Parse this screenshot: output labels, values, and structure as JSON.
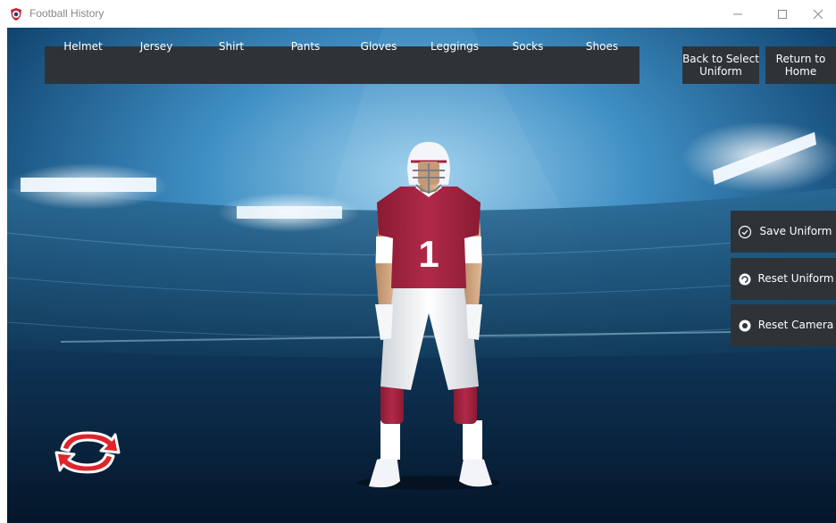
{
  "window": {
    "title": "Football History",
    "controls": [
      "minimize-icon",
      "maximize-icon",
      "close-icon"
    ]
  },
  "tabs": [
    "Helmet",
    "Jersey",
    "Shirt",
    "Pants",
    "Gloves",
    "Leggings",
    "Socks",
    "Shoes"
  ],
  "nav": {
    "back_line1": "Back to Select",
    "back_line2": "Uniform",
    "home_line1": "Return to",
    "home_line2": "Home"
  },
  "actions": {
    "save": "Save Uniform",
    "reset_uniform": "Reset Uniform",
    "reset_camera": "Reset Camera"
  },
  "player": {
    "number": "1"
  },
  "colors": {
    "accent_red": "#a7233f",
    "toolbar_bg": "#2e3338",
    "rotate_red": "#e0242b"
  },
  "icons": {
    "save": "check-circle-icon",
    "reset_uniform": "reset-icon",
    "reset_camera": "camera-reset-icon",
    "rotate": "rotate-arrows-icon"
  }
}
